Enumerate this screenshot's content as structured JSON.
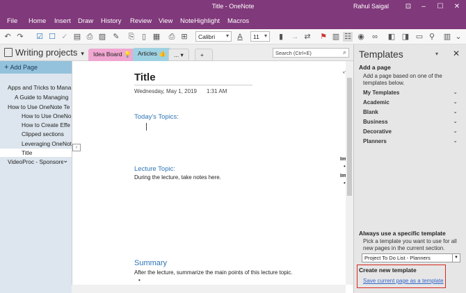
{
  "window": {
    "title": "Title - OneNote",
    "user": "Rahul Saigal"
  },
  "menu": [
    "File",
    "Home",
    "Insert",
    "Draw",
    "History",
    "Review",
    "View",
    "NoteHighlight",
    "Macros"
  ],
  "ribbon": {
    "font_name": "Calibri",
    "font_size": "11"
  },
  "notebook": {
    "name": "Writing projects",
    "tabs": [
      "Idea Board",
      "Articles",
      "...",
      "+"
    ],
    "active_tab": "Articles"
  },
  "search": {
    "placeholder": "Search (Ctrl+E)"
  },
  "pages": {
    "add_page": "Add Page",
    "items": [
      "Apps and Tricks to Mana",
      "A Guide to Managing",
      "How to Use OneNote Te",
      "How to Use OneNo",
      "How to Create Effe",
      "Clipped sections",
      "Leveraging OneNot",
      "Title",
      "VideoProc - Sponsored"
    ],
    "selected": "Title"
  },
  "page": {
    "title": "Title",
    "date": "Wednesday, May 1, 2019",
    "time": "1:31 AM",
    "todays_topics": "Today's Topics:",
    "lecture_topic": "Lecture Topic:",
    "lecture_body": "During the lecture, take notes here.",
    "summary": "Summary",
    "summary_body": "After the lecture, summarize the main points of this lecture topic.",
    "frag_1": "Im",
    "frag_2": "Im"
  },
  "templates": {
    "title": "Templates",
    "add_a_page": "Add a page",
    "add_desc": "Add a page based on one of the templates below.",
    "categories": [
      "My Templates",
      "Academic",
      "Blank",
      "Business",
      "Decorative",
      "Planners"
    ],
    "always_use": "Always use a specific template",
    "always_desc": "Pick a template you want to use for all new pages in the current section.",
    "selected_template": "Project To Do List - Planners",
    "create_new": "Create new template",
    "save_link": "Save current page as a template"
  },
  "colors": {
    "title_bar": "#80397b",
    "pages_header": "#94c2dc",
    "heading_blue": "#2e74b5",
    "highlight_box": "#d9261c",
    "link": "#3366cc"
  }
}
